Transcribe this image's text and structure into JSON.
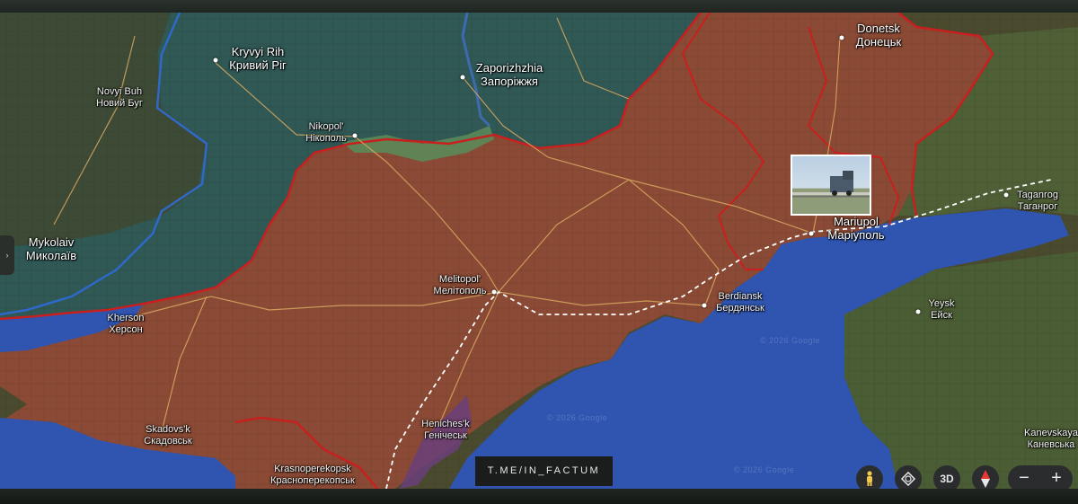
{
  "cities": [
    {
      "id": "kryvyi-rih",
      "latin": "Kryvyi Rih",
      "cyrillic": "Кривий Ріг"
    },
    {
      "id": "zaporizhzhia",
      "latin": "Zaporizhzhia",
      "cyrillic": "Запоріжжя"
    },
    {
      "id": "donetsk",
      "latin": "Donetsk",
      "cyrillic": "Донецьк"
    },
    {
      "id": "novyi-buh",
      "latin": "Novyi Buh",
      "cyrillic": "Новий Буг"
    },
    {
      "id": "nikopol",
      "latin": "Nikopol'",
      "cyrillic": "Нікополь"
    },
    {
      "id": "mykolaiv",
      "latin": "Mykolaiv",
      "cyrillic": "Миколаїв"
    },
    {
      "id": "melitopol",
      "latin": "Melitopol'",
      "cyrillic": "Мелітополь"
    },
    {
      "id": "mariupol",
      "latin": "Mariupol",
      "cyrillic": "Маріуполь"
    },
    {
      "id": "taganrog",
      "latin": "Taganrog",
      "cyrillic": "Таганрог"
    },
    {
      "id": "berdiansk",
      "latin": "Berdiansk",
      "cyrillic": "Бердянськ"
    },
    {
      "id": "kherson",
      "latin": "Kherson",
      "cyrillic": "Херсон"
    },
    {
      "id": "yeysk",
      "latin": "Yeysk",
      "cyrillic": "Ейск"
    },
    {
      "id": "skadovsk",
      "latin": "Skadovs'k",
      "cyrillic": "Скадовськ"
    },
    {
      "id": "henichesk",
      "latin": "Heniches'k",
      "cyrillic": "Генічеськ"
    },
    {
      "id": "kanevskaya",
      "latin": "Kanevskaya",
      "cyrillic": "Каневська"
    },
    {
      "id": "krasnoperekopsk",
      "latin": "Krasnoperekopsk",
      "cyrillic": "Красноперекопськ"
    }
  ],
  "watermarks": {
    "google_1": "© 2026 Google",
    "google_2": "© 2026 Google",
    "google_3": "© 2026 Google"
  },
  "telegram_handle": "T.ME/IN_FACTUM",
  "controls": {
    "view_3d": "3D",
    "zoom_out": "−",
    "zoom_in": "+",
    "side_tab_arrow": "›"
  },
  "icons": {
    "street_view": "pegman-icon",
    "rotate": "rotate-icon",
    "compass": "compass-icon"
  },
  "colors": {
    "water": "#2f55b0",
    "occupied_fill": "#8a4a35",
    "ukraine_fill": "#2c5a5c",
    "front_line": "#c81f1f",
    "ukraine_border": "#2f6bd6",
    "roads": "#d7a860",
    "railway": "#ffffff"
  }
}
